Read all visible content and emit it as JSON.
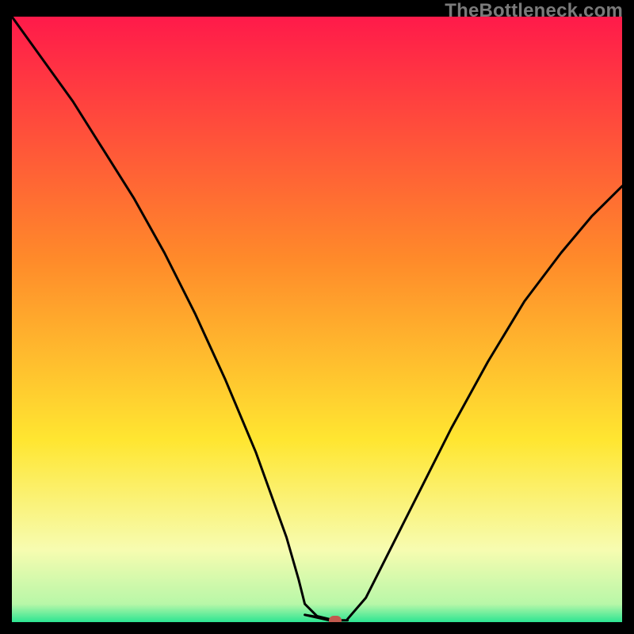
{
  "watermark": "TheBottleneck.com",
  "colors": {
    "top": "#ff1a4a",
    "mid_upper": "#ff8a2a",
    "mid": "#ffe631",
    "low_band": "#f7fcb0",
    "bottom": "#2de592",
    "curve": "#000000",
    "marker": "#c25a4e",
    "frame": "#000000"
  },
  "chart_data": {
    "type": "line",
    "title": "",
    "xlabel": "",
    "ylabel": "",
    "xlim": [
      0,
      100
    ],
    "ylim": [
      0,
      100
    ],
    "series": [
      {
        "name": "bottleneck-curve-left",
        "x": [
          0,
          5,
          10,
          15,
          20,
          25,
          30,
          35,
          40,
          45,
          47,
          48,
          50,
          52
        ],
        "y": [
          100,
          93,
          86,
          78,
          70,
          61,
          51,
          40,
          28,
          14,
          7,
          3,
          1,
          0.5
        ]
      },
      {
        "name": "bottleneck-curve-floor",
        "x": [
          48,
          52,
          55
        ],
        "y": [
          1.2,
          0.3,
          0.3
        ]
      },
      {
        "name": "bottleneck-curve-right",
        "x": [
          55,
          58,
          62,
          67,
          72,
          78,
          84,
          90,
          95,
          100
        ],
        "y": [
          0.5,
          4,
          12,
          22,
          32,
          43,
          53,
          61,
          67,
          72
        ]
      }
    ],
    "annotations": [
      {
        "name": "minimum-marker",
        "x": 53,
        "y": 0.3
      }
    ],
    "gradient_stops": [
      {
        "pos": 0.0,
        "color": "#ff1a4a"
      },
      {
        "pos": 0.4,
        "color": "#ff8a2a"
      },
      {
        "pos": 0.7,
        "color": "#ffe631"
      },
      {
        "pos": 0.88,
        "color": "#f7fcb0"
      },
      {
        "pos": 0.97,
        "color": "#b8f7a8"
      },
      {
        "pos": 1.0,
        "color": "#2de592"
      }
    ]
  }
}
